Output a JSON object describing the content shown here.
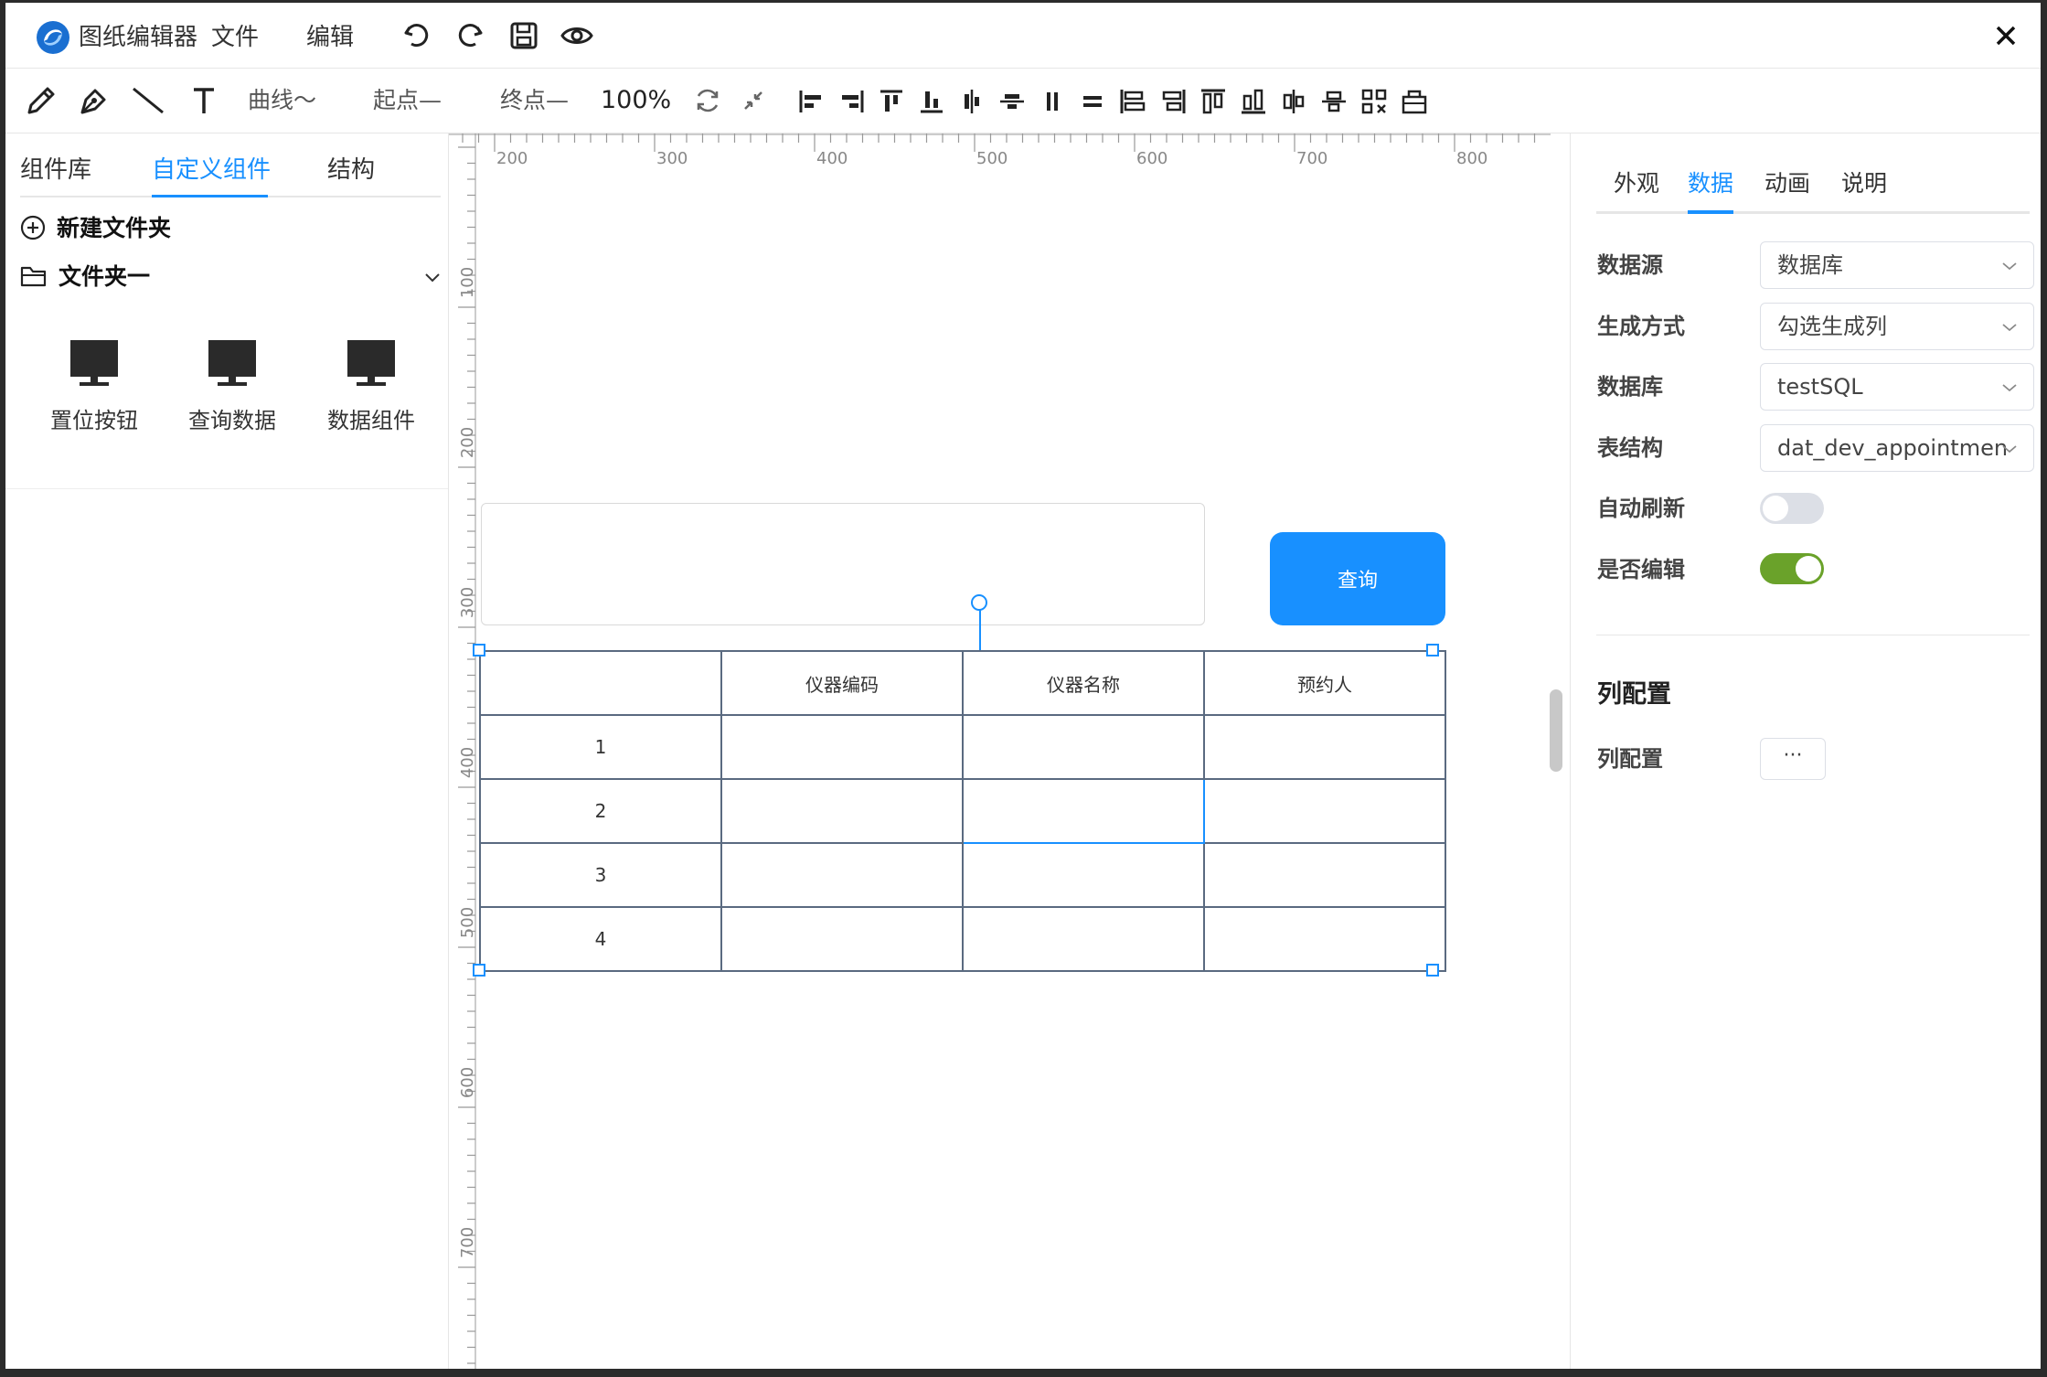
{
  "app": {
    "title": "图纸编辑器"
  },
  "menu": {
    "file": "文件",
    "edit": "编辑"
  },
  "toolbar": {
    "curve": "曲线～",
    "start_point": "起点—",
    "end_point": "终点—",
    "zoom": "100%"
  },
  "left_panel": {
    "tabs": [
      "组件库",
      "自定义组件",
      "结构"
    ],
    "active_tab": "自定义组件",
    "new_folder": "新建文件夹",
    "folder": "文件夹一",
    "components": [
      {
        "label": "置位按钮",
        "icon": "monitor-icon"
      },
      {
        "label": "查询数据",
        "icon": "monitor-icon"
      },
      {
        "label": "数据组件",
        "icon": "monitor-icon"
      }
    ]
  },
  "canvas": {
    "ruler_top": [
      "200",
      "300",
      "400",
      "500",
      "600",
      "700",
      "800"
    ],
    "ruler_left": [
      "100",
      "200",
      "300",
      "400",
      "500",
      "600",
      "700"
    ],
    "query_button": "查询",
    "table": {
      "headers": [
        "",
        "仪器编码",
        "仪器名称",
        "预约人"
      ],
      "rows": [
        [
          "1",
          "",
          "",
          ""
        ],
        [
          "2",
          "",
          "",
          ""
        ],
        [
          "3",
          "",
          "",
          ""
        ],
        [
          "4",
          "",
          "",
          ""
        ]
      ]
    }
  },
  "right_panel": {
    "tabs": [
      "外观",
      "数据",
      "动画",
      "说明"
    ],
    "active_tab": "数据",
    "fields": {
      "datasource": {
        "label": "数据源",
        "value": "数据库"
      },
      "gen_mode": {
        "label": "生成方式",
        "value": "勾选生成列"
      },
      "database": {
        "label": "数据库",
        "value": "testSQL"
      },
      "table_struct": {
        "label": "表结构",
        "value": "dat_dev_appointmen"
      }
    },
    "auto_refresh": {
      "label": "自动刷新",
      "on": false
    },
    "editable": {
      "label": "是否编辑",
      "on": true
    },
    "column_section": "列配置",
    "column_config": {
      "label": "列配置",
      "button": "···"
    }
  },
  "colors": {
    "accent": "#1890ff",
    "toggle_on": "#6aa22a",
    "toggle_off": "#dcdfe6"
  }
}
